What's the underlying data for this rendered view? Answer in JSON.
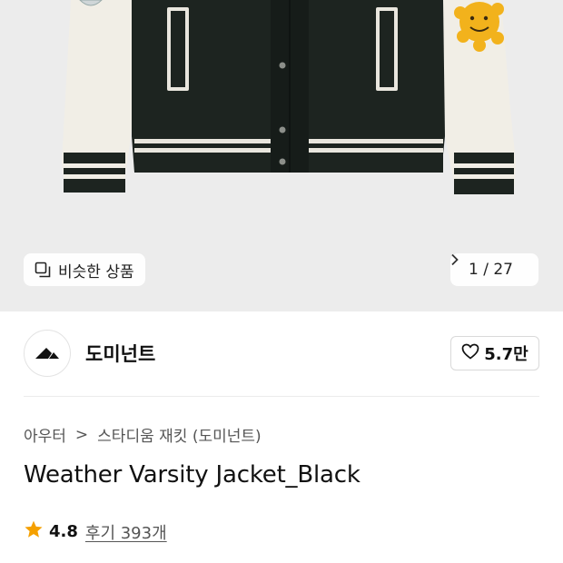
{
  "hero": {
    "similar_label": "비슷한 상품",
    "pager_current": "1",
    "pager_sep": "/",
    "pager_total": "27",
    "bg_color": "#ececec"
  },
  "brand": {
    "name": "도미넌트",
    "likes": "5.7만"
  },
  "product": {
    "breadcrumb": [
      "아우터",
      "스타디움 재킷 (도미넌트)"
    ],
    "breadcrumb_sep": ">",
    "title": "Weather Varsity Jacket_Black",
    "rating": "4.8",
    "reviews": "후기 393개"
  },
  "colors": {
    "star": "#f5a000",
    "jacket_body": "#1d2420",
    "sleeve": "#f1eee6",
    "patch": "#f2b21c"
  },
  "icons": {
    "similar": "copy-icon",
    "pager_next": "chevron-right-icon",
    "like": "heart-icon",
    "rating": "star-icon",
    "brand_logo": "dominant-logo"
  }
}
